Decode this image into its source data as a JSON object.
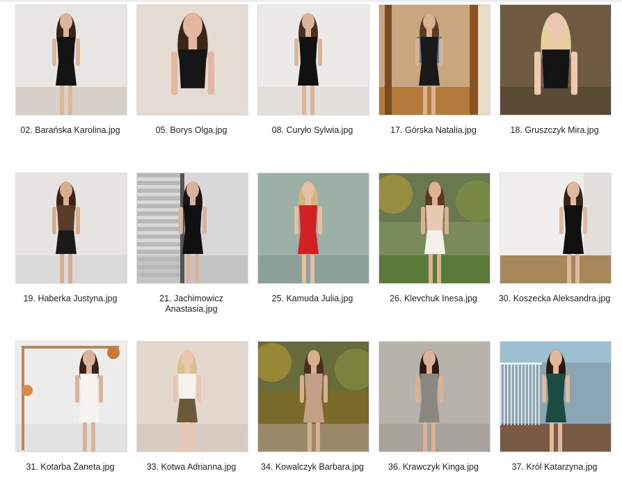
{
  "gallery": {
    "files": [
      {
        "name": "02. Barańska Karolina.jpg",
        "bg": "#e8e6e4",
        "floor": "#d6d0c8",
        "dress": "#141414",
        "skin": "#dcb59c",
        "hair": "#3a2418",
        "pose": "dress"
      },
      {
        "name": "05. Borys Olga.jpg",
        "bg": "#e4dcd2",
        "floor": "#e4dcd2",
        "dress": "#161616",
        "skin": "#e2b9a0",
        "hair": "#3c2619",
        "pose": "close"
      },
      {
        "name": "08. Curyło Sylwia.jpg",
        "bg": "#eceae8",
        "floor": "#e2dfdb",
        "dress": "#111111",
        "skin": "#dcb49a",
        "hair": "#4a3020",
        "pose": "dress"
      },
      {
        "name": "17. Górska Natalia.jpg",
        "bg": "#c8a680",
        "floor": "#b47a3c",
        "dress": "#1a1a1a",
        "skin": "#d9b090",
        "hair": "#5a3a22",
        "pose": "mirror",
        "jacket": "#5a7aa0"
      },
      {
        "name": "18. Gruszczyk Mira.jpg",
        "bg": "#6e5a42",
        "floor": "#5a4a34",
        "dress": "#141414",
        "skin": "#ecc8b0",
        "hair": "#e6cf9a",
        "pose": "close"
      },
      {
        "name": "19. Haberka Justyna.jpg",
        "bg": "#e6e4e2",
        "floor": "#dadada",
        "dress": "#1c1a18",
        "skin": "#d8ae90",
        "hair": "#3a2418",
        "pose": "dress",
        "top": "#5a3a28"
      },
      {
        "name": "21. Jachimowicz Anastasia.jpg",
        "bg": "#d8d8d8",
        "floor": "#c4c4c4",
        "dress": "#101010",
        "skin": "#dcb29a",
        "hair": "#1e1410",
        "pose": "blinds"
      },
      {
        "name": "25. Kamuda Julia.jpg",
        "bg": "#9cb0a8",
        "floor": "#8aa098",
        "dress": "#d42020",
        "skin": "#e6bea4",
        "hair": "#d4b47a",
        "pose": "dress"
      },
      {
        "name": "26. Klevchuk Inesa.jpg",
        "bg": "#7a8a5a",
        "floor": "#5a7a3a",
        "dress": "#f4f0ea",
        "skin": "#dcb090",
        "hair": "#5a3a22",
        "pose": "outdoor",
        "top": "#e8c8b0"
      },
      {
        "name": "30. Koszecka Aleksandra.jpg",
        "bg": "#f0efed",
        "floor": "#a8885a",
        "dress": "#101010",
        "skin": "#e0b89e",
        "hair": "#3a2418",
        "pose": "room"
      },
      {
        "name": "31. Kotarba Żaneta.jpg",
        "bg": "#ececec",
        "floor": "#e2e2e2",
        "dress": "#f6f4f0",
        "skin": "#dcb49a",
        "hair": "#3a2418",
        "pose": "arch"
      },
      {
        "name": "33. Kotwa Adrianna.jpg",
        "bg": "#e4d8ce",
        "floor": "#d8ccc2",
        "dress": "#6a5a3a",
        "skin": "#ecc6ac",
        "hair": "#d8c090",
        "pose": "dress",
        "top": "#f6f2ec"
      },
      {
        "name": "34. Kowalczyk Barbara.jpg",
        "bg": "#7a6a2a",
        "floor": "#9a8a6a",
        "dress": "#c4a088",
        "skin": "#d8b090",
        "hair": "#4a3020",
        "pose": "outdoor",
        "top": "#c4a088"
      },
      {
        "name": "36. Krawczyk Kinga.jpg",
        "bg": "#b8b2ac",
        "floor": "#a8a29c",
        "dress": "#8a8680",
        "skin": "#dcb296",
        "hair": "#2a1a12",
        "pose": "dress"
      },
      {
        "name": "37. Król Katarzyna.jpg",
        "bg": "#8aa6b4",
        "floor": "#7a5a44",
        "dress": "#1e4a44",
        "skin": "#e0b89c",
        "hair": "#2a1a12",
        "pose": "bridge"
      }
    ]
  }
}
